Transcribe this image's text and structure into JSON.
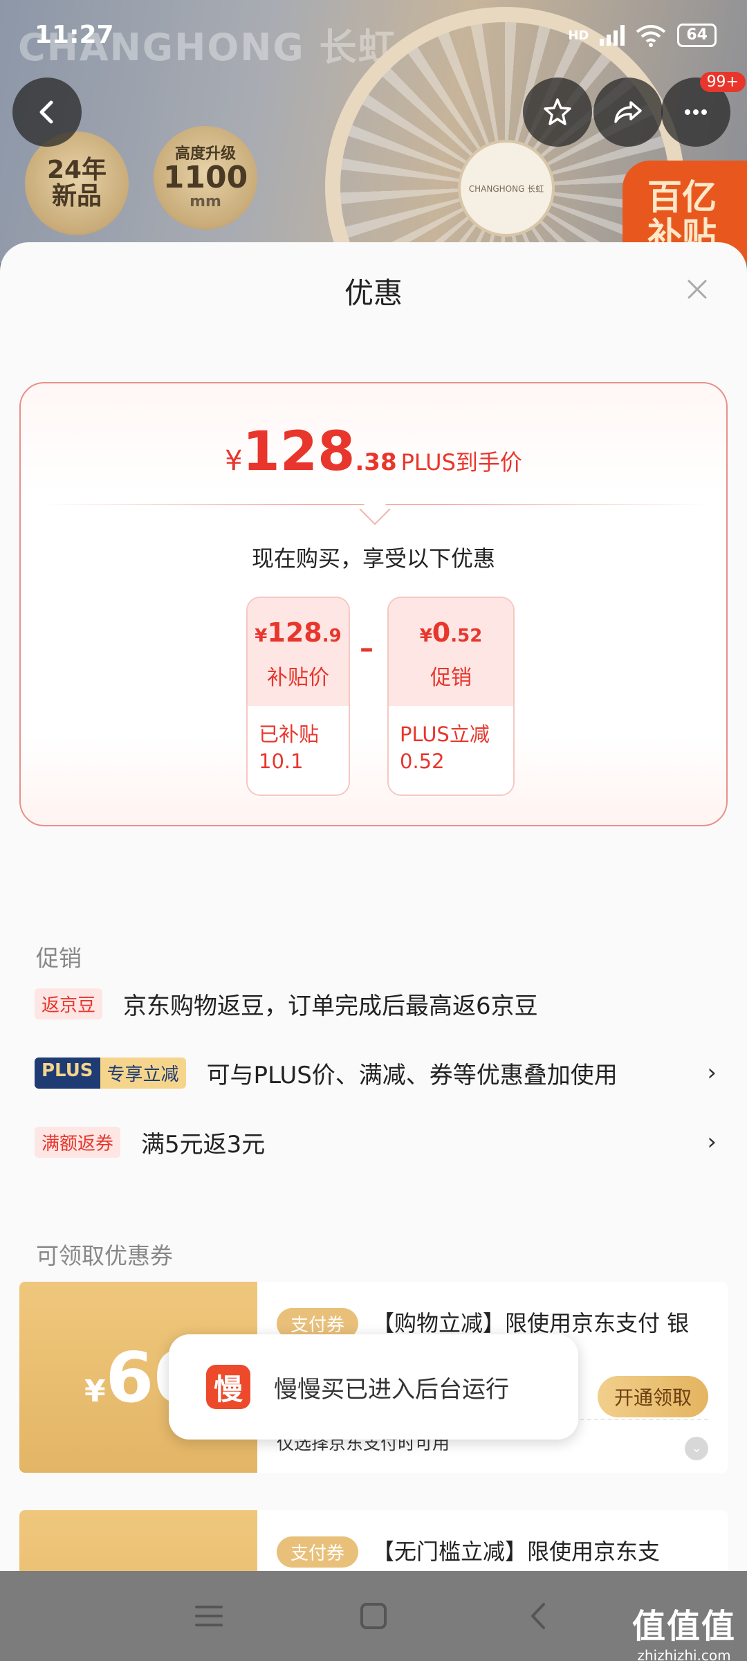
{
  "status": {
    "time": "11:27",
    "network": "HD",
    "battery": "64"
  },
  "hero": {
    "brand_text": "CHANGHONG 长虹",
    "fan_logo": "CHANGHONG 长虹",
    "medal1": [
      "24年",
      "新品"
    ],
    "medal2": {
      "top": "高度升级",
      "value": "1100",
      "unit": "mm"
    },
    "subsidy_badge": [
      "百亿",
      "补贴"
    ],
    "notification_count": "99+"
  },
  "sheet": {
    "title": "优惠",
    "price_card": {
      "currency": "¥",
      "price_int": "128",
      "price_dec": ".38",
      "price_label": "PLUS到手价",
      "subtitle": "现在购买，享受以下优惠",
      "operator": "–",
      "items": [
        {
          "currency": "¥",
          "value_int": "128",
          "value_dec": ".9",
          "label": "补贴价",
          "detail_line1": "已补贴",
          "detail_line2": "10.1"
        },
        {
          "currency": "¥",
          "value_int": "0",
          "value_dec": ".52",
          "label": "促销",
          "detail_line1": "PLUS立减",
          "detail_line2": "0.52"
        }
      ]
    },
    "promotions": {
      "section_title": "促销",
      "rows": [
        {
          "tag": "返京豆",
          "text": "京东购物返豆，订单完成后最高返6京豆",
          "chevron": ""
        },
        {
          "tag_part1": "PLUS",
          "tag_part2": "专享立减",
          "text": "可与PLUS价、满减、券等优惠叠加使用",
          "chevron": "›"
        },
        {
          "tag": "满额返券",
          "text": "满5元返3元",
          "chevron": "›"
        }
      ]
    },
    "coupons": {
      "section_title": "可领取优惠券",
      "items": [
        {
          "currency": "¥",
          "amount": "60",
          "type": "支付券",
          "description": "【购物立减】限使用京东支付 银台结…",
          "condition": "仅选择京东支付时可用",
          "button": "开通领取"
        },
        {
          "currency": "¥",
          "amount": "",
          "type": "支付券",
          "description": "【无门槛立减】限使用京东支",
          "condition": "",
          "button": ""
        }
      ]
    }
  },
  "toast": {
    "logo_char": "慢",
    "message": "慢慢买已进入后台运行"
  },
  "watermark": {
    "line1": "值值值",
    "line2": "zhizhizhi.com"
  }
}
